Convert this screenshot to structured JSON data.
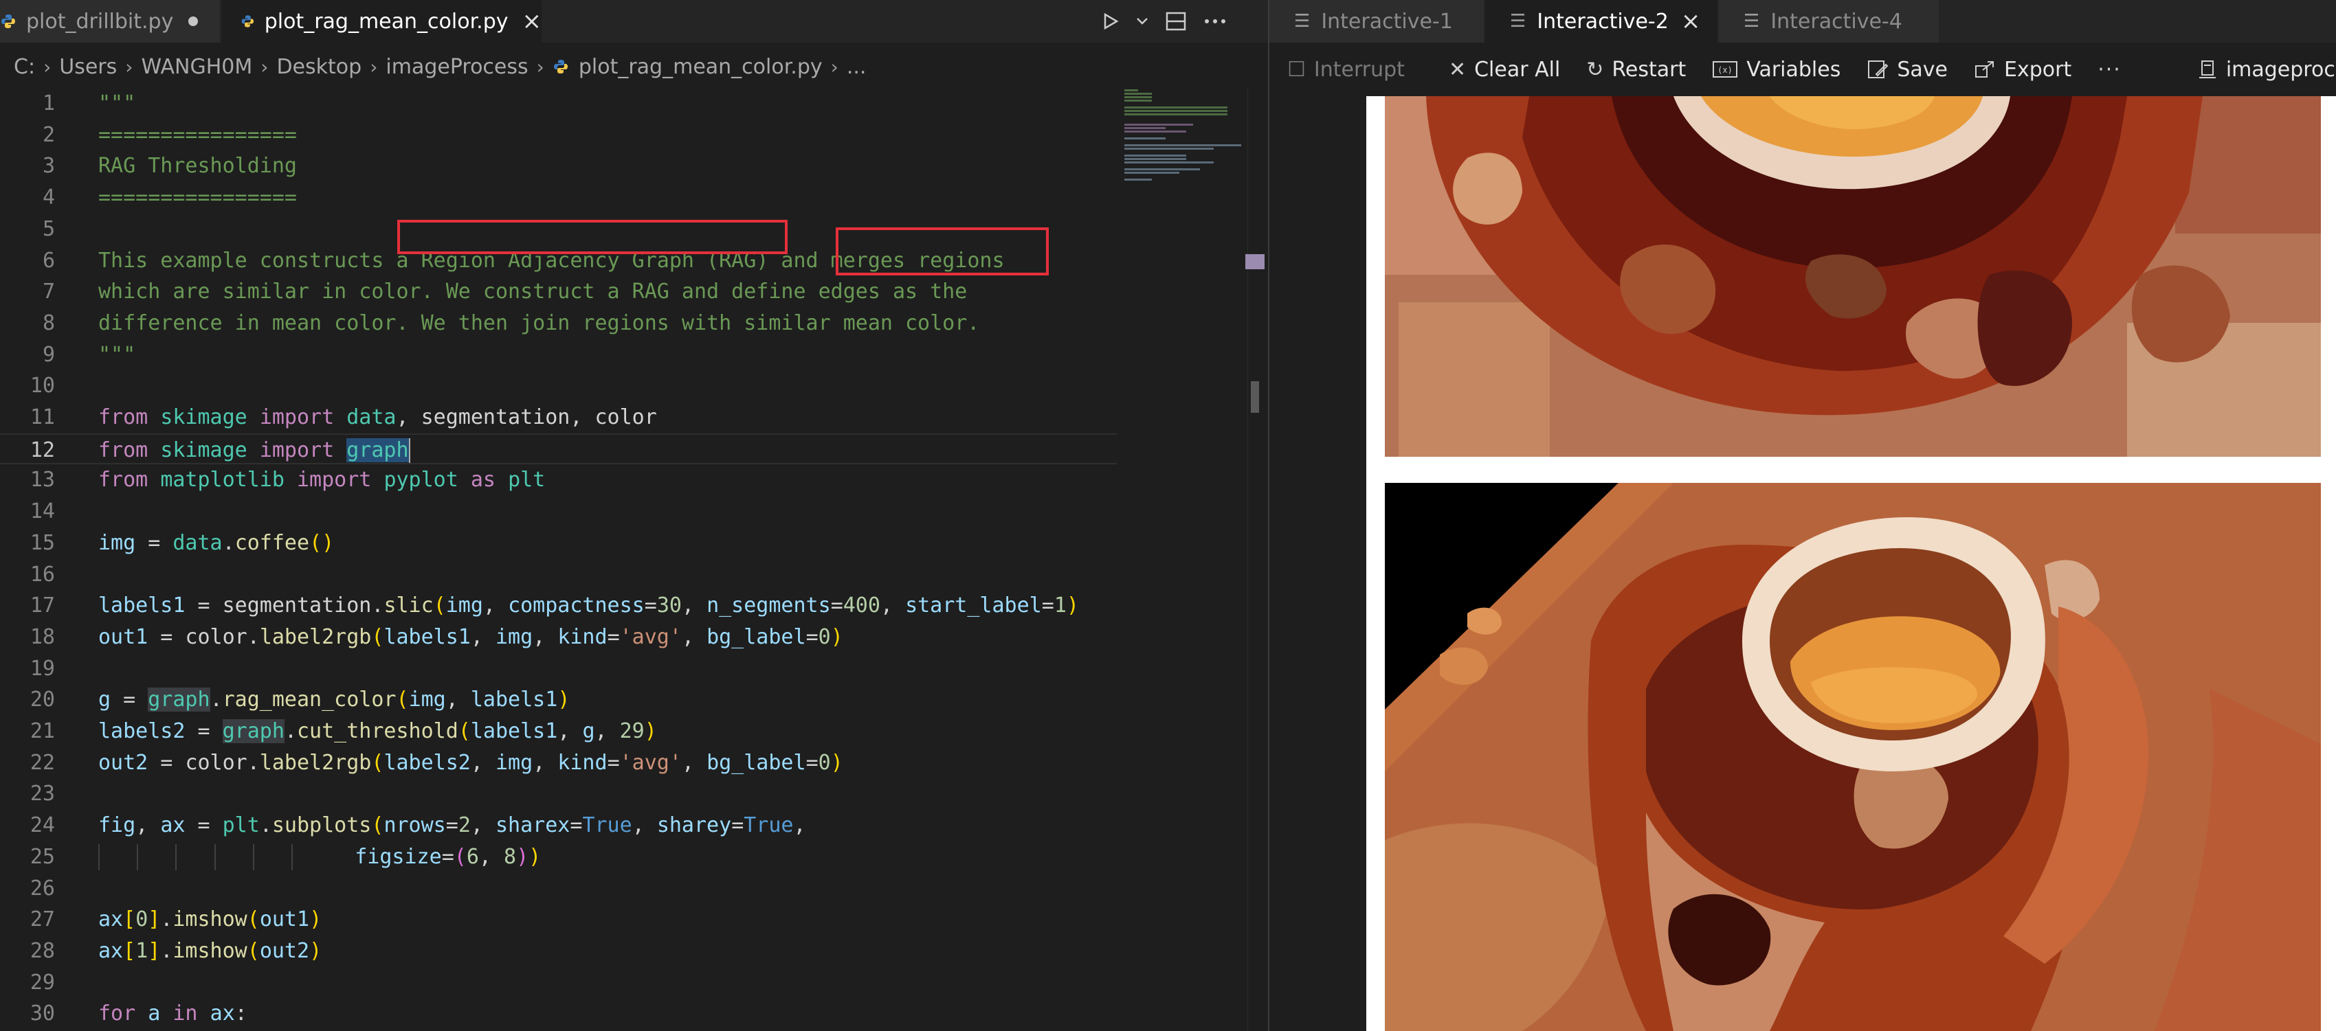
{
  "editor": {
    "tabs": [
      {
        "label": "plot_drillbit.py",
        "modified": true,
        "active": false
      },
      {
        "label": "plot_rag_mean_color.py",
        "modified": false,
        "active": true
      }
    ],
    "breadcrumb": [
      "C:",
      "Users",
      "WANGH0M",
      "Desktop",
      "imageProcess",
      "plot_rag_mean_color.py",
      "..."
    ],
    "actions": {
      "run_icon": "play-icon",
      "dropdown_icon": "chevron-down-icon",
      "split_icon": "split-editor-icon",
      "more_icon": "ellipsis-icon"
    },
    "line_numbers": [
      "1",
      "2",
      "3",
      "4",
      "5",
      "6",
      "7",
      "8",
      "9",
      "10",
      "11",
      "12",
      "13",
      "14",
      "15",
      "16",
      "17",
      "18",
      "19",
      "20",
      "21",
      "22",
      "23",
      "24",
      "25",
      "26",
      "27",
      "28",
      "29",
      "30"
    ],
    "current_line": "12",
    "code": {
      "l1": "\"\"\"",
      "l2": "================",
      "l3": "RAG Thresholding",
      "l4": "================",
      "l6a": "This example constructs ",
      "l6b": "a Region Adjacency Graph (RAG)",
      "l6c": " and ",
      "l6d": "merges regions",
      "l7": "which are similar in color. We construct a RAG and define edges as the",
      "l8": "difference in mean color. We then join regions with similar mean color.",
      "l9": "\"\"\"",
      "from": "from",
      "import": "import",
      "as": "as",
      "for": "for",
      "in": "in",
      "skimage": "skimage",
      "matplotlib": "matplotlib",
      "data": "data",
      "segmentation": "segmentation",
      "color": "color",
      "graph": "graph",
      "pyplot": "pyplot",
      "plt": "plt",
      "img": "img",
      "coffee": "coffee",
      "labels1": "labels1",
      "labels2": "labels2",
      "slic": "slic",
      "compactness": "compactness",
      "n_segments": "n_segments",
      "start_label": "start_label",
      "n30": "30",
      "n400": "400",
      "n1": "1",
      "n29": "29",
      "n0": "0",
      "n6": "6",
      "n8": "8",
      "out1": "out1",
      "out2": "out2",
      "label2rgb": "label2rgb",
      "kind": "kind",
      "avg": "'avg'",
      "bg_label": "bg_label",
      "g": "g",
      "rag_mean_color": "rag_mean_color",
      "cut_threshold": "cut_threshold",
      "fig": "fig",
      "ax": "ax",
      "subplots": "subplots",
      "nrows": "nrows",
      "n2": "2",
      "sharex": "sharex",
      "sharey": "sharey",
      "True": "True",
      "figsize": "figsize",
      "imshow": "imshow",
      "a": "a"
    }
  },
  "interactive": {
    "tabs": [
      {
        "label": "Interactive-1",
        "active": false
      },
      {
        "label": "Interactive-2",
        "active": true
      },
      {
        "label": "Interactive-4",
        "active": false
      }
    ],
    "toolbar": {
      "interrupt": "Interrupt",
      "clear_all": "Clear All",
      "restart": "Restart",
      "variables": "Variables",
      "save": "Save",
      "export": "Export",
      "kernel": "imageproces"
    }
  },
  "colors": {
    "annotation_box": "#e5303b",
    "docstring": "#6a9955",
    "keyword": "#c586c0",
    "accent_selection": "#264f78"
  }
}
